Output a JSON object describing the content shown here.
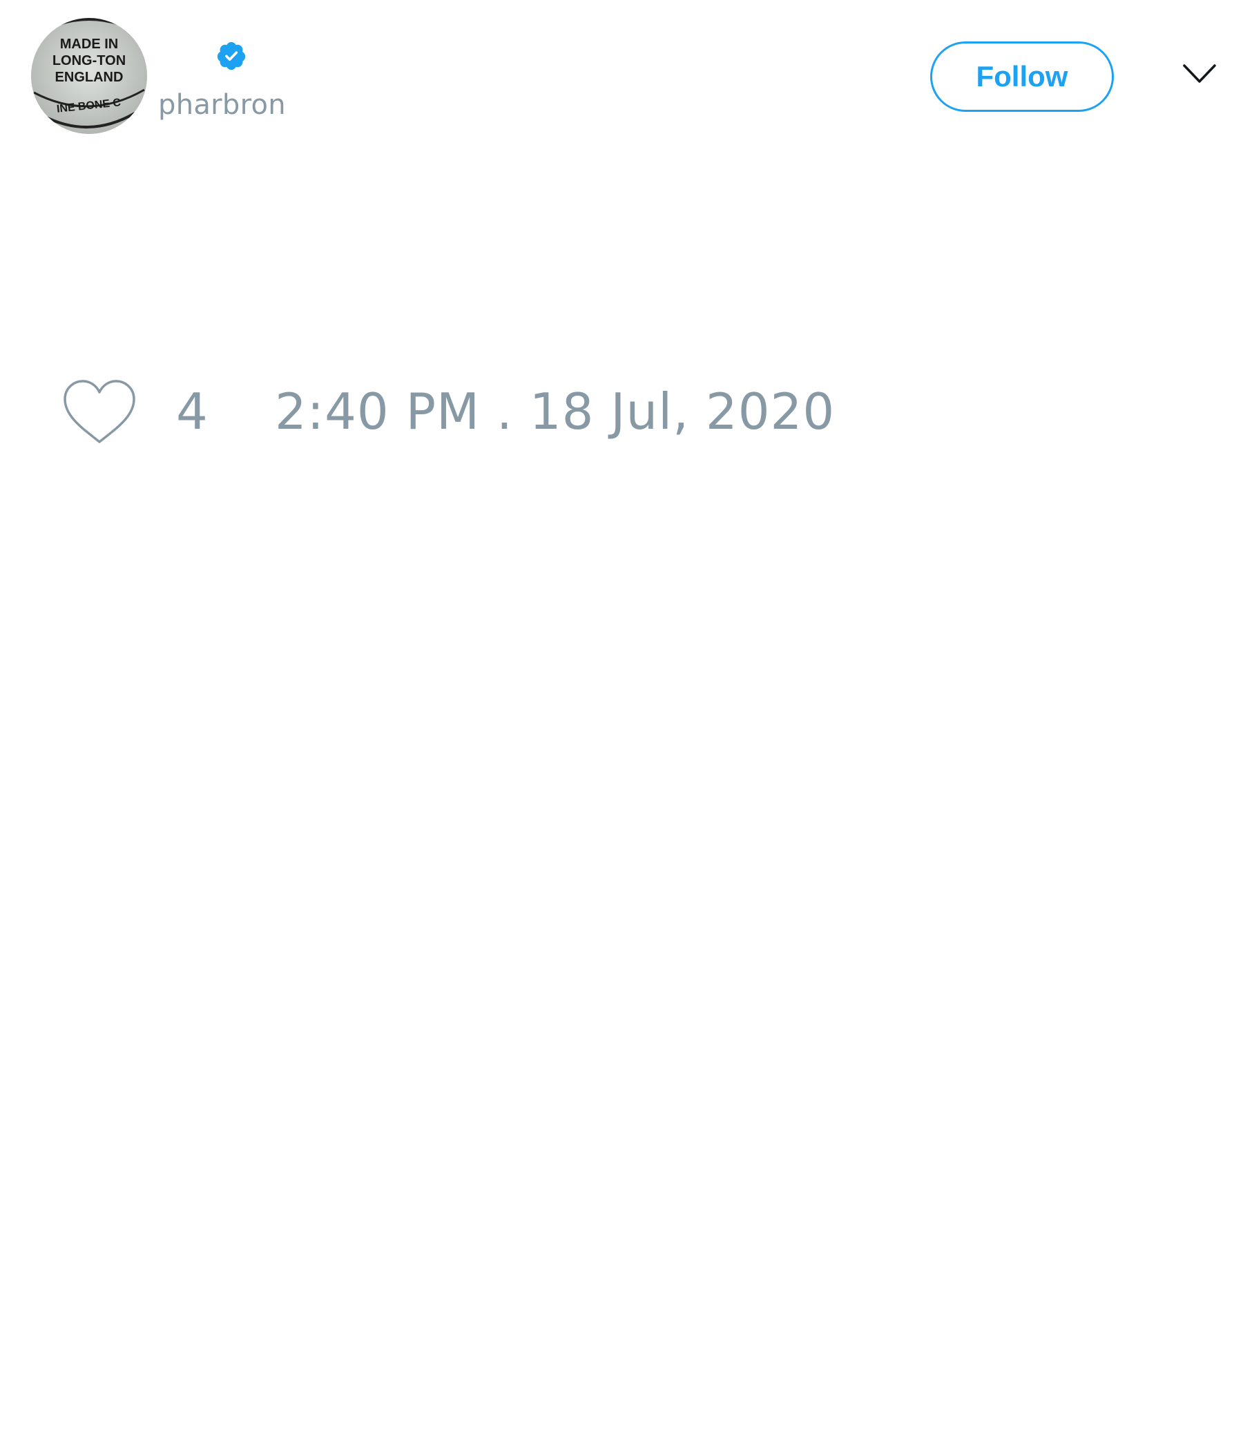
{
  "tweet": {
    "author": {
      "handle": "pharbron",
      "verified": true,
      "avatar_stamp_lines": [
        "MADE IN",
        "LONG-TON",
        "ENGLAND",
        "INE BONE C"
      ]
    },
    "follow_label": "Follow",
    "likes": "4",
    "timestamp": "2:40 PM . 18 Jul, 2020"
  },
  "colors": {
    "accent": "#1da1f2",
    "muted_text": "#8899a6",
    "background": "#ffffff"
  },
  "icons": {
    "verified": "verified-badge-icon",
    "menu": "chevron-down-icon",
    "like": "heart-icon"
  }
}
